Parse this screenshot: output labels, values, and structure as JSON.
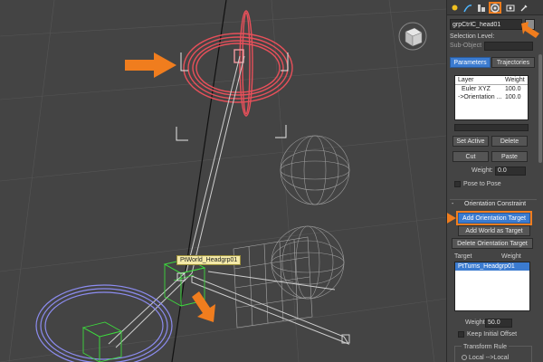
{
  "tooltip": "PtWorld_Headgrp01",
  "panel": {
    "object_name": "grpCtrlC_head01",
    "selection_level_label": "Selection Level:",
    "sub_object_label": "Sub-Object",
    "tabs": {
      "parameters": "Parameters",
      "trajectories": "Trajectories"
    },
    "layer_list": {
      "col_layer": "Layer",
      "col_weight": "Weight",
      "rows": [
        {
          "layer": "Euler XYZ",
          "weight": "100.0"
        },
        {
          "layer": "->Orientation ...",
          "weight": "100.0"
        }
      ]
    },
    "buttons": {
      "set_active": "Set Active",
      "delete": "Delete",
      "cut": "Cut",
      "paste": "Paste",
      "add_orientation_target": "Add Orientation Target",
      "add_world_as_target": "Add World as Target",
      "delete_orientation_target": "Delete Orientation Target"
    },
    "weight_label": "Weight:",
    "weight_value": "0.0",
    "pose_to_pose": "Pose to Pose",
    "rollout_title": "Orientation Constraint",
    "target_list": {
      "col_target": "Target",
      "col_weight": "Weight",
      "rows": [
        {
          "target": "PtTurns_Headgrp01",
          "weight": ""
        }
      ]
    },
    "constraint_weight_label": "Weight",
    "constraint_weight_value": "50.0",
    "keep_initial_offset": "Keep Initial Offset",
    "transform_rule": "Transform Rule",
    "local_to_local": "Local -->Local"
  },
  "colors": {
    "accent_orange": "#f07d1e",
    "active_blue": "#3b7bd0",
    "ring_red": "#e8505a",
    "ring_blue": "#8c8cf0",
    "helper_green": "#3ed83e"
  },
  "icons": [
    "sun-icon",
    "curve-icon",
    "hierarchy-icon",
    "motion-icon",
    "display-icon",
    "utilities-icon",
    "viewcube-icon"
  ]
}
